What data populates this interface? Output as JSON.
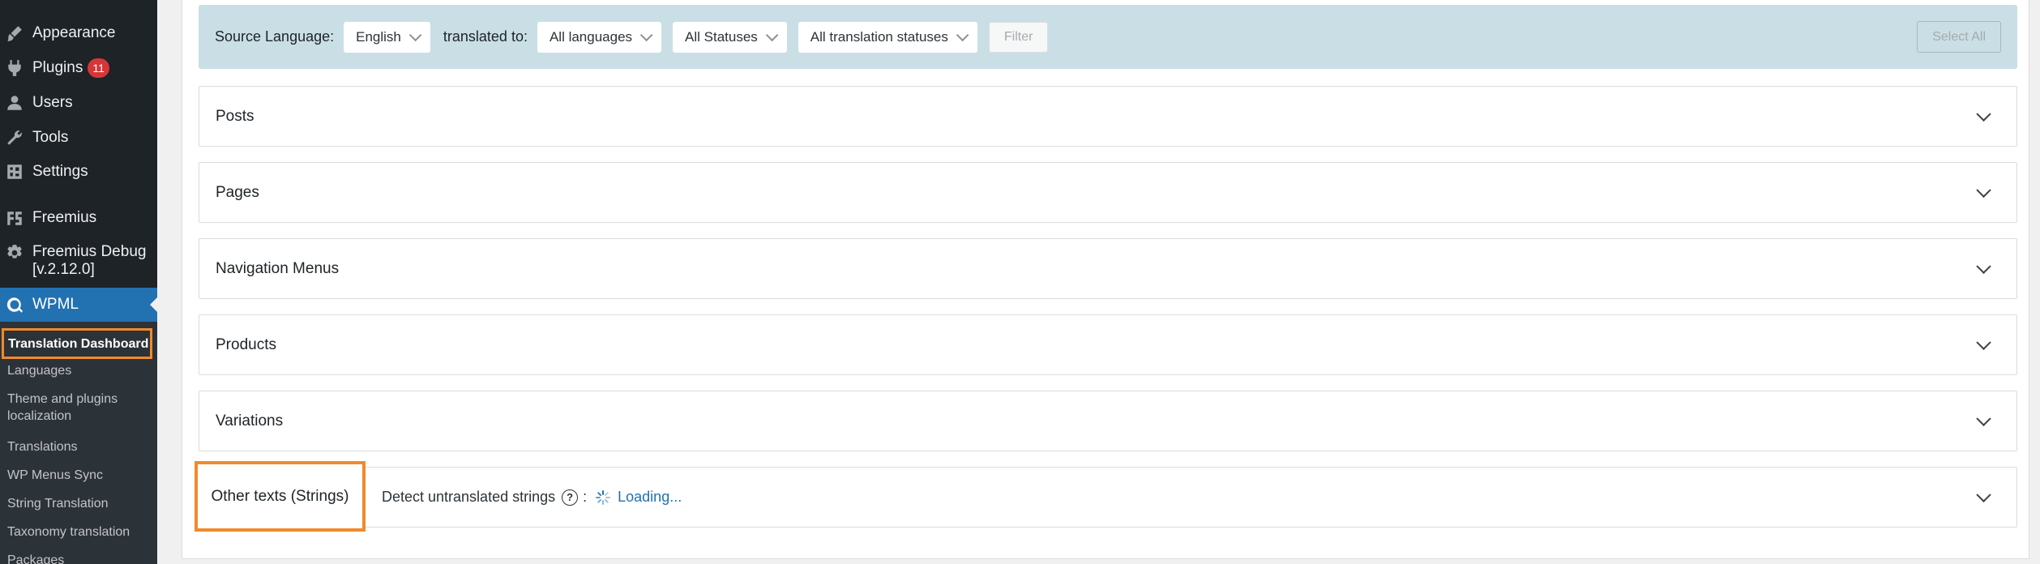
{
  "sidebar": {
    "items": [
      {
        "label": "Appearance",
        "icon": "brush-icon"
      },
      {
        "label": "Plugins",
        "badge": "11",
        "icon": "plug-icon"
      },
      {
        "label": "Users",
        "icon": "user-icon"
      },
      {
        "label": "Tools",
        "icon": "wrench-icon"
      },
      {
        "label": "Settings",
        "icon": "settings-icon"
      },
      {
        "label": "Freemius",
        "icon": "freemius-icon"
      },
      {
        "label_line1": "Freemius Debug",
        "label_line2": "[v.2.12.0]",
        "icon": "gear-icon"
      },
      {
        "label": "WPML",
        "icon": "wpml-icon"
      }
    ],
    "submenu": [
      {
        "label": "Translation Dashboard"
      },
      {
        "label": "Languages"
      },
      {
        "label_line1": "Theme and plugins",
        "label_line2": "localization"
      },
      {
        "label": "Translations"
      },
      {
        "label": "WP Menus Sync"
      },
      {
        "label": "String Translation"
      },
      {
        "label": "Taxonomy translation"
      },
      {
        "label": "Packages"
      }
    ]
  },
  "filters": {
    "source_label": "Source Language:",
    "source_value": "English",
    "translated_label": "translated to:",
    "languages_value": "All languages",
    "status_value": "All Statuses",
    "translation_status_value": "All translation statuses",
    "filter_button": "Filter",
    "select_all_button": "Select All"
  },
  "sections": [
    {
      "title": "Posts"
    },
    {
      "title": "Pages"
    },
    {
      "title": "Navigation Menus"
    },
    {
      "title": "Products"
    },
    {
      "title": "Variations"
    },
    {
      "title": "Other texts (Strings)"
    }
  ],
  "strings": {
    "detect_label": "Detect untranslated strings",
    "help_glyph": "?",
    "colon": ":",
    "loading": "Loading..."
  },
  "colors": {
    "sidebar_bg": "#1d2327",
    "active_bg": "#2271b1",
    "highlight": "#f08a2c",
    "filter_bar_bg": "#c9dfe5",
    "badge": "#d63638"
  }
}
